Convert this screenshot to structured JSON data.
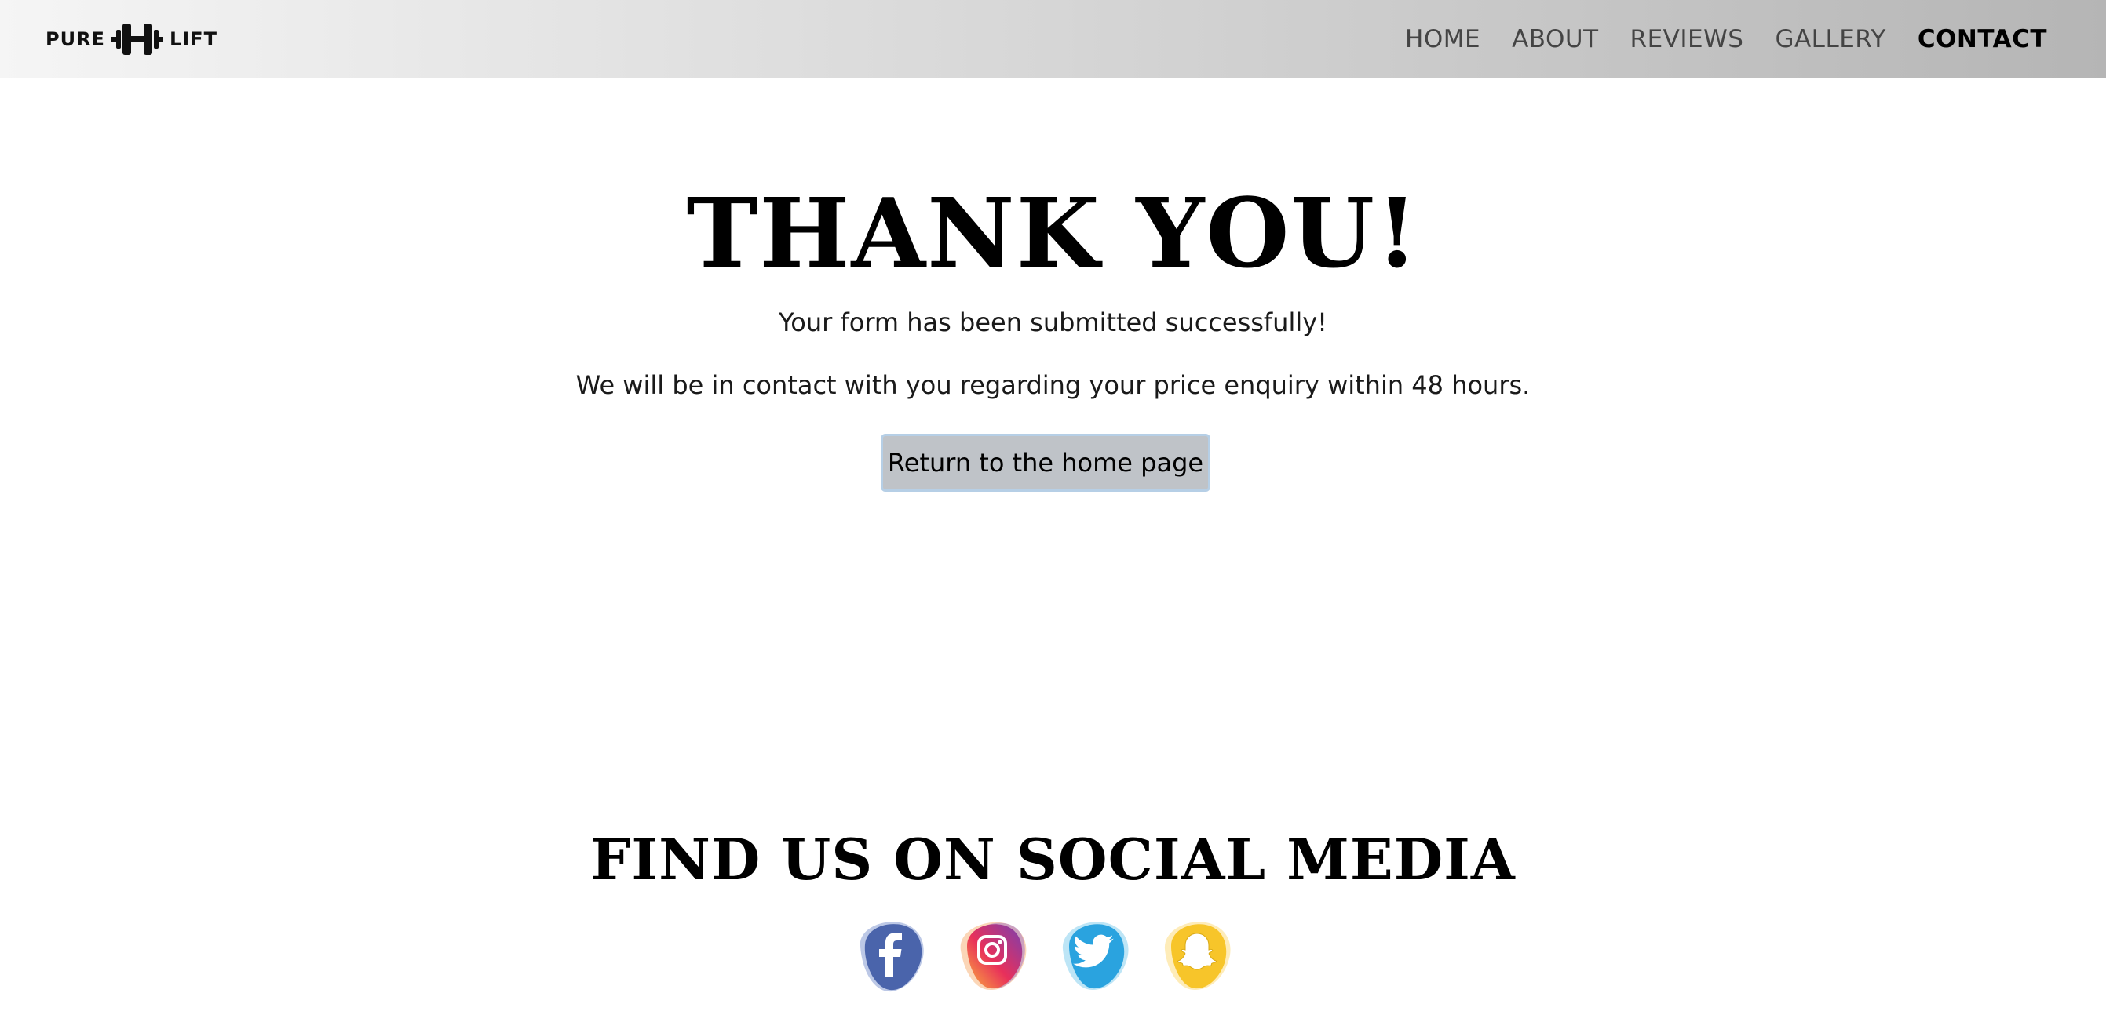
{
  "header": {
    "logo": {
      "left": "PURE",
      "right": "LIFT"
    },
    "nav": [
      {
        "label": "HOME",
        "active": false
      },
      {
        "label": "ABOUT",
        "active": false
      },
      {
        "label": "REVIEWS",
        "active": false
      },
      {
        "label": "GALLERY",
        "active": false
      },
      {
        "label": "CONTACT",
        "active": true
      }
    ]
  },
  "main": {
    "title": "THANK YOU!",
    "message_1": "Your form has been submitted successfully!",
    "message_2": "We will be in contact with you regarding your price enquiry within 48 hours.",
    "button_label": "Return to the home page"
  },
  "social": {
    "title": "FIND US ON SOCIAL MEDIA",
    "icons": [
      {
        "name": "facebook-icon",
        "color": "#4a64ab"
      },
      {
        "name": "instagram-icon",
        "color": "#d6306f"
      },
      {
        "name": "twitter-icon",
        "color": "#2aa3df"
      },
      {
        "name": "snapchat-icon",
        "color": "#f7c52a"
      }
    ]
  }
}
